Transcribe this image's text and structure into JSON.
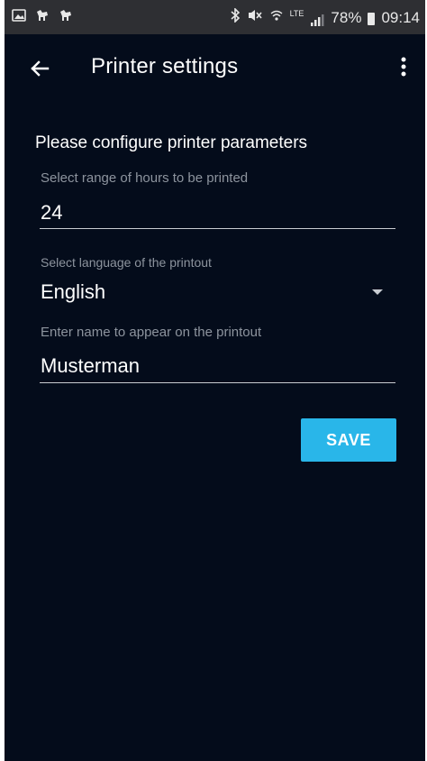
{
  "status_bar": {
    "battery_percent": "78%",
    "time": "09:14",
    "network": "LTE"
  },
  "toolbar": {
    "title": "Printer settings"
  },
  "form": {
    "heading": "Please configure printer parameters",
    "hours_field": {
      "label": "Select range of hours to be printed",
      "value": "24"
    },
    "language_field": {
      "label": "Select language of the printout",
      "selected": "English"
    },
    "name_field": {
      "label": "Enter name to appear on the printout",
      "value": "Musterman"
    },
    "save_label": "SAVE"
  },
  "colors": {
    "background": "#040c1b",
    "status_bar": "#2e2f33",
    "accent": "#29b6e9"
  },
  "icons": {
    "back": "arrow-left-icon",
    "more": "more-vert-icon",
    "dropdown": "dropdown-arrow-icon"
  }
}
